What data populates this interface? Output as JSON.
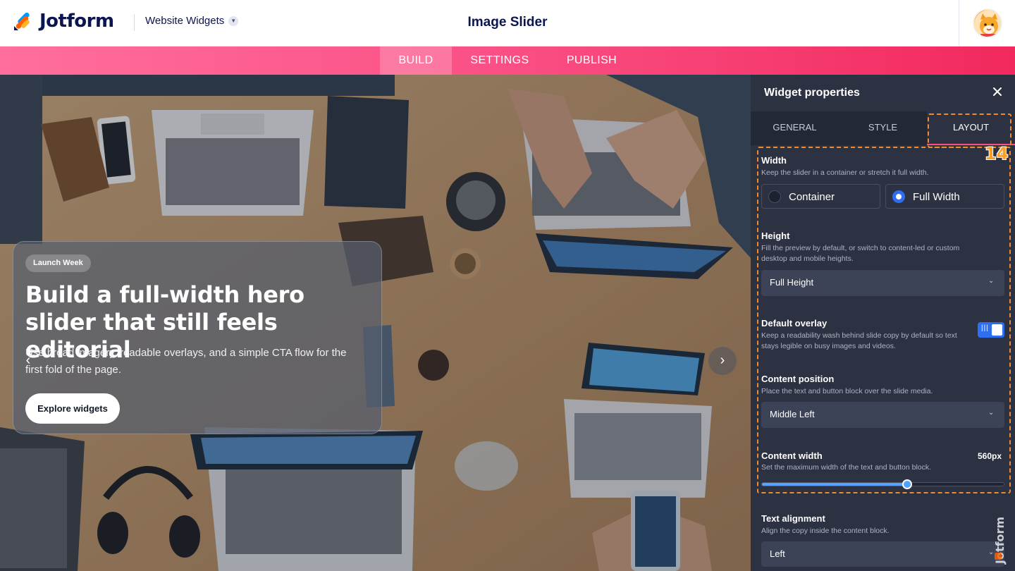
{
  "header": {
    "brand": "Jotform",
    "product_switch": "Website Widgets",
    "page_title": "Image Slider"
  },
  "tabs": {
    "build": "BUILD",
    "settings": "SETTINGS",
    "publish": "PUBLISH",
    "active": "BUILD"
  },
  "slide": {
    "badge": "Launch Week",
    "title": "Build a full-width hero slider that still feels editorial",
    "subtitle": "Use broad imagery, readable overlays, and a simple CTA flow for the first fold of the page.",
    "cta": "Explore widgets",
    "prev_arrow": "‹",
    "next_arrow": "›"
  },
  "panel": {
    "title": "Widget properties",
    "tabs": {
      "general": "GENERAL",
      "style": "STYLE",
      "layout": "LAYOUT",
      "active": "LAYOUT"
    },
    "step_marker": "14",
    "width": {
      "title": "Width",
      "desc": "Keep the slider in a container or stretch it full width.",
      "option_container": "Container",
      "option_full": "Full Width",
      "selected": "Full Width"
    },
    "height": {
      "title": "Height",
      "desc": "Fill the preview by default, or switch to content-led or custom desktop and mobile heights.",
      "value": "Full Height"
    },
    "overlay": {
      "title": "Default overlay",
      "desc": "Keep a readability wash behind slide copy by default so text stays legible on busy images and videos.",
      "enabled": true
    },
    "content_position": {
      "title": "Content position",
      "desc": "Place the text and button block over the slide media.",
      "value": "Middle Left"
    },
    "content_width": {
      "title": "Content width",
      "desc": "Set the maximum width of the text and button block.",
      "value": "560px",
      "slider_fraction": 0.6
    },
    "text_alignment": {
      "title": "Text alignment",
      "desc": "Align the copy inside the content block.",
      "value": "Left"
    }
  },
  "colors": {
    "brand_navy": "#0a1551",
    "tab_pink": "#fa4f84",
    "panel_bg": "#2d3242",
    "accent_blue": "#2e6ff2",
    "highlight_orange": "#f08a2c"
  }
}
